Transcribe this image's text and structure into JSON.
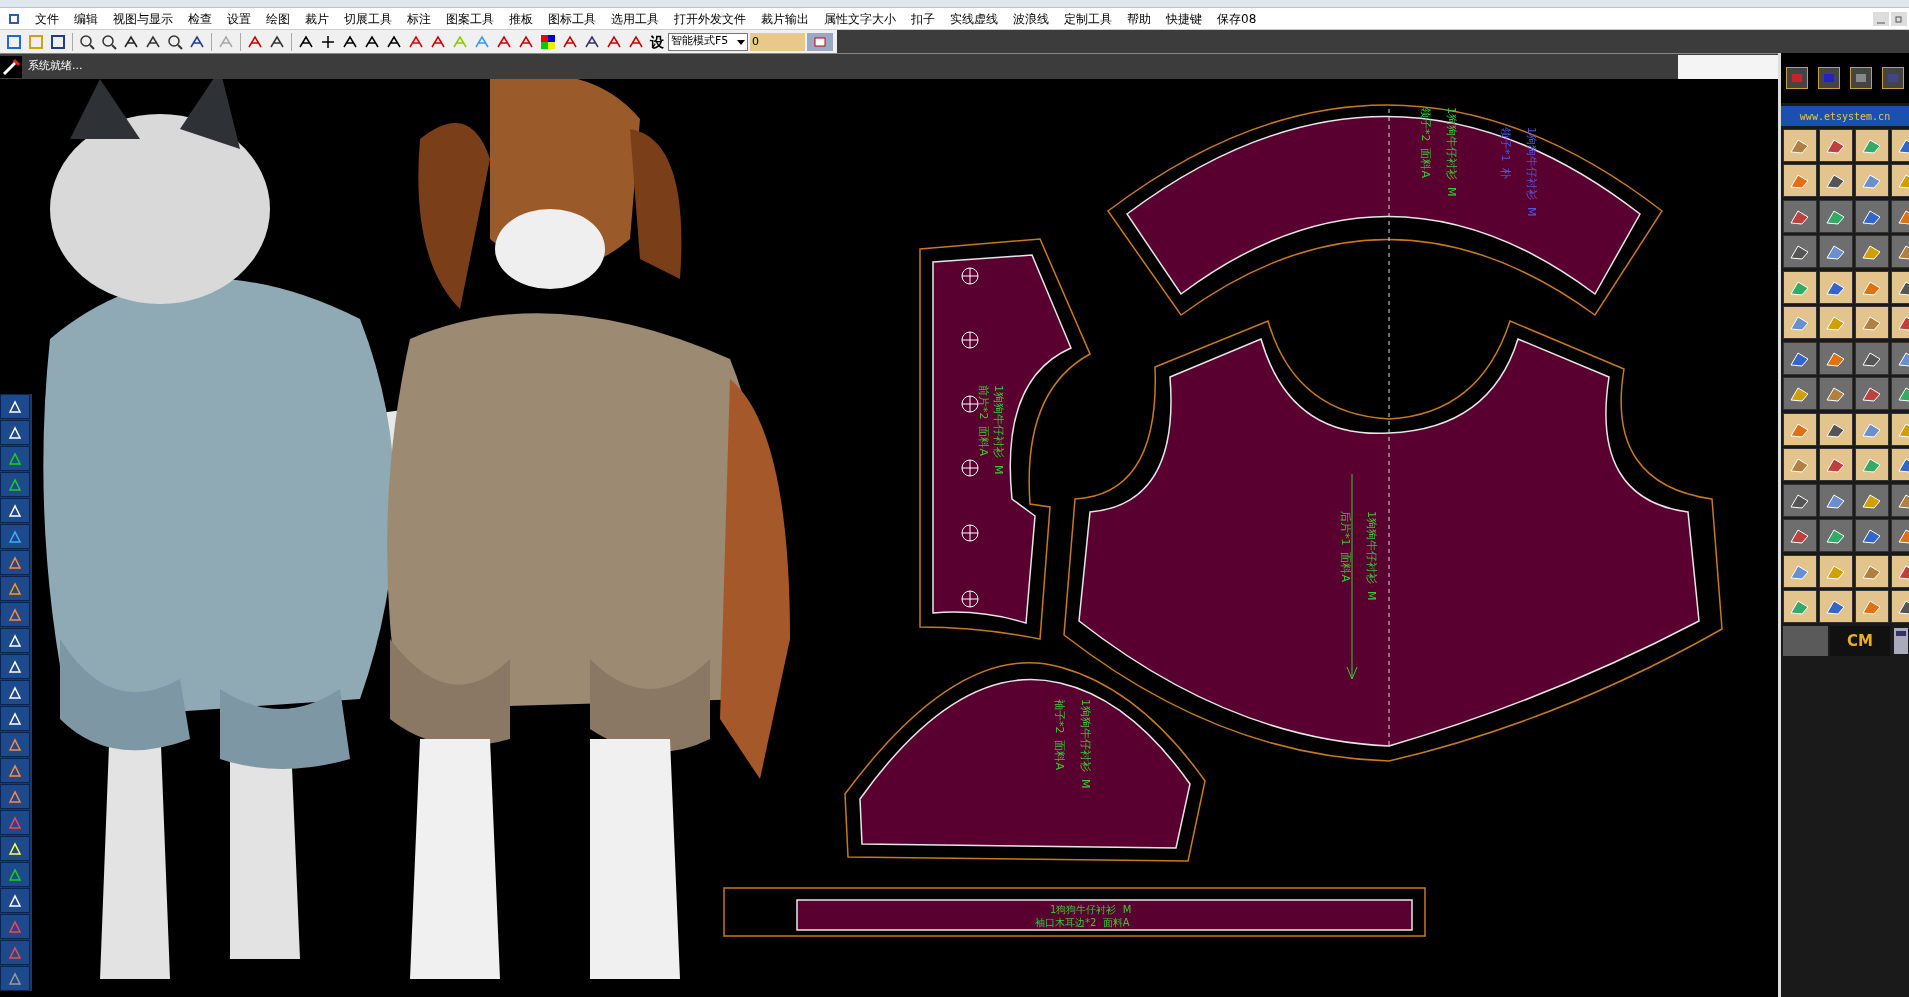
{
  "menu": [
    "文件",
    "编辑",
    "视图与显示",
    "检查",
    "设置",
    "绘图",
    "裁片",
    "切展工具",
    "标注",
    "图案工具",
    "推板",
    "图标工具",
    "选用工具",
    "打开外发文件",
    "裁片输出",
    "属性文字大小",
    "扣子",
    "实线虚线",
    "波浪线",
    "定制工具",
    "帮助",
    "快捷键",
    "保存08"
  ],
  "toolbar": {
    "set_button": "设",
    "mode_select": "智能模式F5",
    "value_field": "0"
  },
  "status": "系统就绪...",
  "right_panel": {
    "url": "www.etsystem.cn",
    "unit": "CM"
  },
  "pieces": [
    {
      "kind": "collar",
      "labels": [
        {
          "text": "1狗狗牛仔衬衫  M",
          "color": "#33cc33"
        },
        {
          "text": "领子*2  面料A",
          "color": "#33cc33"
        },
        {
          "text": "1狗狗牛仔衬衫  M",
          "color": "#5555dd"
        },
        {
          "text": "领子*1  朴",
          "color": "#5555dd"
        }
      ]
    },
    {
      "kind": "front",
      "labels": [
        {
          "text": "1狗狗牛仔衬衫  M",
          "color": "#33cc33"
        },
        {
          "text": "前片*2  面料A",
          "color": "#33cc33"
        }
      ]
    },
    {
      "kind": "back",
      "labels": [
        {
          "text": "1狗狗牛仔衬衫  M",
          "color": "#33cc33"
        },
        {
          "text": "后片*1  面料A",
          "color": "#33cc33"
        }
      ]
    },
    {
      "kind": "sleeve",
      "labels": [
        {
          "text": "1狗狗牛仔衬衫  M",
          "color": "#33cc33"
        },
        {
          "text": "袖子*2  面料A",
          "color": "#33cc33"
        }
      ]
    },
    {
      "kind": "cuff",
      "labels": [
        {
          "text": "1狗狗牛仔衬衫  M",
          "color": "#33cc33"
        },
        {
          "text": "袖口木耳边*2  面料A",
          "color": "#33cc33"
        }
      ]
    }
  ]
}
